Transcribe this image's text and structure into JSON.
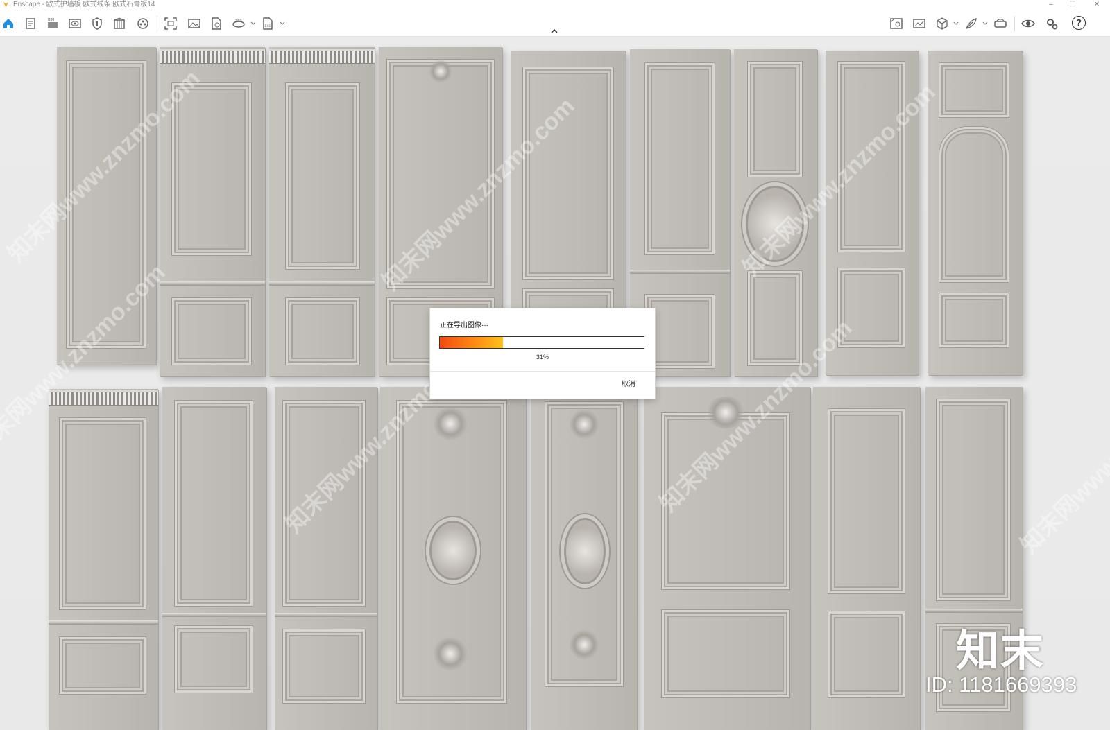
{
  "window": {
    "title": "Enscape - 欧式护墙板 欧式线条 欧式石膏板14",
    "minimize_glyph": "–",
    "maximize_glyph": "☐",
    "close_glyph": "✕",
    "accent": "#f5a31a"
  },
  "toolbar": {
    "left_icons": [
      "home-icon",
      "file-icon",
      "bim-icon",
      "view-icon",
      "shield-icon",
      "library-icon",
      "materials-icon",
      "screenshot-icon",
      "image-icon",
      "render-file-icon",
      "panorama-icon",
      "export-icon"
    ],
    "right_icons": [
      "views-icon",
      "image-export-icon",
      "cube-icon",
      "feather-icon",
      "vr-headset-icon",
      "eye-icon",
      "settings-icon",
      "help-icon"
    ],
    "help_glyph": "?"
  },
  "dialog": {
    "title": "正在导出图像···",
    "progress_value": 0.31,
    "progress_text": "31%",
    "cancel_label": "取消",
    "progress_colors": [
      "#f24a10",
      "#ff8a14",
      "#ffc21a"
    ]
  },
  "watermark": {
    "text": "知末网www.znzmo.com",
    "logo": "知末",
    "id_text": "ID: 1181669393"
  }
}
